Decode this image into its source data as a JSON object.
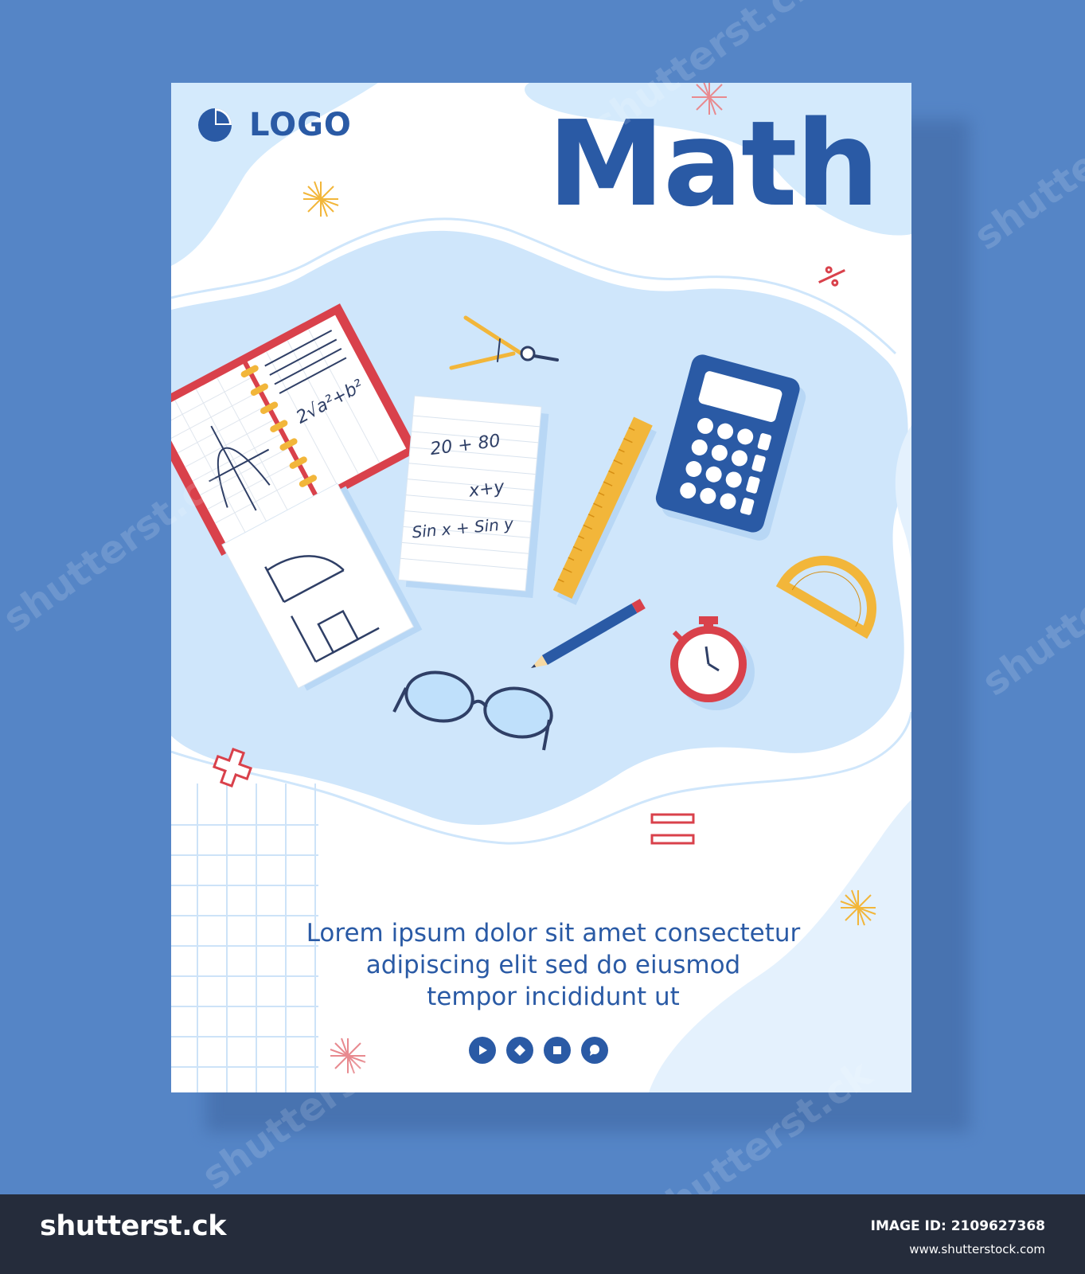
{
  "poster": {
    "logo_text": "LOGO",
    "title": "Math",
    "body_lines": [
      "Lorem ipsum dolor sit amet consectetur",
      "adipiscing elit sed do eiusmod",
      "tempor incididunt ut"
    ],
    "notebook_formula": "2√a²+b²",
    "paper_lines": [
      "20 + 80",
      "x+y",
      "Sin x + Sin y"
    ],
    "social_icons": [
      "play-icon",
      "diamond-icon",
      "stop-icon",
      "chat-icon"
    ]
  },
  "watermark": "shutterst.ck",
  "footer": {
    "brand": "shutterst.ck",
    "image_id": "IMAGE ID: 2109627368",
    "site": "www.shutterstock.com"
  },
  "colors": {
    "background": "#5585c6",
    "accent_blue": "#2a5aa5",
    "light_blue": "#cfe6fb",
    "red": "#d9414b",
    "yellow": "#f2b63a",
    "footer": "#252c3b"
  }
}
